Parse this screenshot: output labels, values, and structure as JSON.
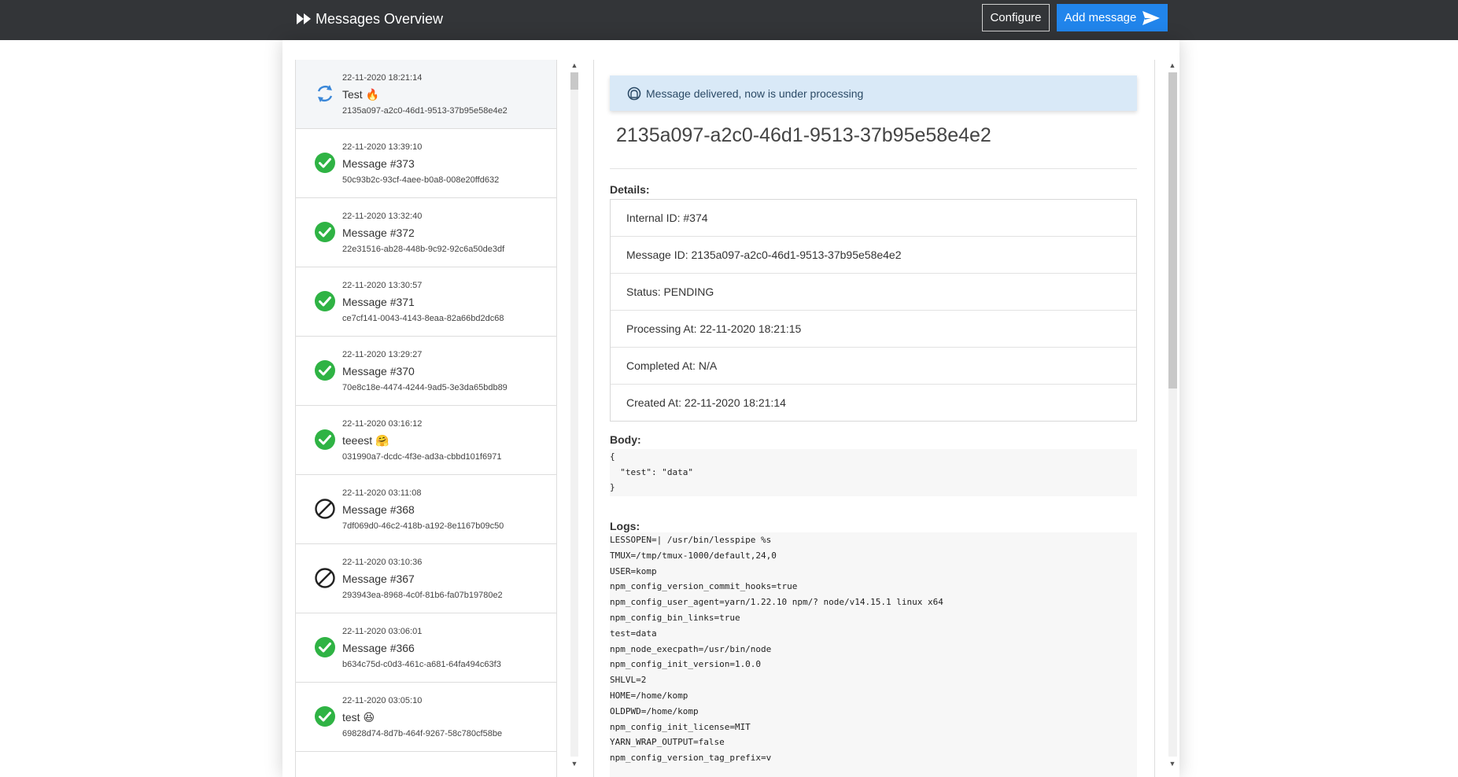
{
  "header": {
    "title": "Messages Overview",
    "configure_label": "Configure",
    "add_label": "Add message"
  },
  "messages": [
    {
      "date": "22-11-2020 18:21:14",
      "title": "Test",
      "emoji": "🔥",
      "uuid": "2135a097-a2c0-46d1-9513-37b95e58e4e2",
      "status": "refresh-icon"
    },
    {
      "date": "22-11-2020 13:39:10",
      "title": "Message #373",
      "emoji": "",
      "uuid": "50c93b2c-93cf-4aee-b0a8-008e20ffd632",
      "status": "check-icon"
    },
    {
      "date": "22-11-2020 13:32:40",
      "title": "Message #372",
      "emoji": "",
      "uuid": "22e31516-ab28-448b-9c92-92c6a50de3df",
      "status": "check-icon"
    },
    {
      "date": "22-11-2020 13:30:57",
      "title": "Message #371",
      "emoji": "",
      "uuid": "ce7cf141-0043-4143-8eaa-82a66bd2dc68",
      "status": "check-icon"
    },
    {
      "date": "22-11-2020 13:29:27",
      "title": "Message #370",
      "emoji": "",
      "uuid": "70e8c18e-4474-4244-9ad5-3e3da65bdb89",
      "status": "check-icon"
    },
    {
      "date": "22-11-2020 03:16:12",
      "title": "teeest",
      "emoji": "🤗",
      "uuid": "031990a7-dcdc-4f3e-ad3a-cbbd101f6971",
      "status": "check-icon"
    },
    {
      "date": "22-11-2020 03:11:08",
      "title": "Message #368",
      "emoji": "",
      "uuid": "7df069d0-46c2-418b-a192-8e1167b09c50",
      "status": "blocked-icon"
    },
    {
      "date": "22-11-2020 03:10:36",
      "title": "Message #367",
      "emoji": "",
      "uuid": "293943ea-8968-4c0f-81b6-fa07b19780e2",
      "status": "blocked-icon"
    },
    {
      "date": "22-11-2020 03:06:01",
      "title": "Message #366",
      "emoji": "",
      "uuid": "b634c75d-c0d3-461c-a681-64fa494c63f3",
      "status": "check-icon"
    },
    {
      "date": "22-11-2020 03:05:10",
      "title": "test",
      "emoji": "😆",
      "uuid": "69828d74-8d7b-464f-9267-58c780cf58be",
      "status": "check-icon"
    }
  ],
  "detail": {
    "alert": "Message delivered, now is under processing",
    "message_id": "2135a097-a2c0-46d1-9513-37b95e58e4e2",
    "details_label": "Details:",
    "rows": [
      "Internal ID: #374",
      "Message ID: 2135a097-a2c0-46d1-9513-37b95e58e4e2",
      "Status: PENDING",
      "Processing At: 22-11-2020 18:21:15",
      "Completed At: N/A",
      "Created At: 22-11-2020 18:21:14"
    ],
    "body_label": "Body:",
    "body": "{\n  \"test\": \"data\"\n}",
    "logs_label": "Logs:",
    "logs": "LESSOPEN=| /usr/bin/lesspipe %s\nTMUX=/tmp/tmux-1000/default,24,0\nUSER=komp\nnpm_config_version_commit_hooks=true\nnpm_config_user_agent=yarn/1.22.10 npm/? node/v14.15.1 linux x64\nnpm_config_bin_links=true\ntest=data\nnpm_node_execpath=/usr/bin/node\nnpm_config_init_version=1.0.0\nSHLVL=2\nHOME=/home/komp\nOLDPWD=/home/komp\nnpm_config_init_license=MIT\nYARN_WRAP_OUTPUT=false\nnpm_config_version_tag_prefix=v"
  },
  "colors": {
    "topbar": "#333538",
    "primary": "#2185ec",
    "success": "#2fb344",
    "alert_bg": "#d9e9f7"
  }
}
